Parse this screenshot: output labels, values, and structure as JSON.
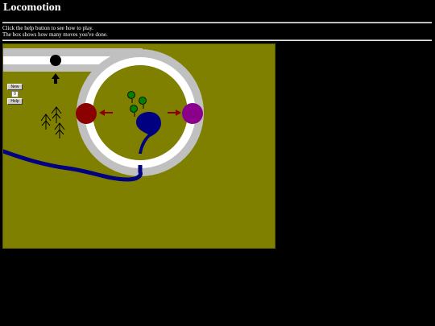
{
  "page": {
    "title": "Locomotion"
  },
  "instructions": {
    "line1": "Click the help button to see how to play.",
    "line2": "The box shows how many moves you've done."
  },
  "controls": {
    "new_label": "New",
    "moves_value": "0",
    "help_label": "Help"
  },
  "game": {
    "colors": {
      "ground": "#808000",
      "track_outer": "#c0c0c0",
      "track_inner": "#ffffff",
      "water": "#000080",
      "red_station": "#8b0000",
      "purple_station": "#8b008b",
      "arrow": "#8b0000",
      "tree": "#008000"
    },
    "pieces": [
      "black-ball",
      "red-station",
      "purple-station"
    ],
    "icons": [
      "up-arrow-icon",
      "left-arrow-icon",
      "right-arrow-icon",
      "pine-tree-icon",
      "round-tree-icon"
    ]
  }
}
